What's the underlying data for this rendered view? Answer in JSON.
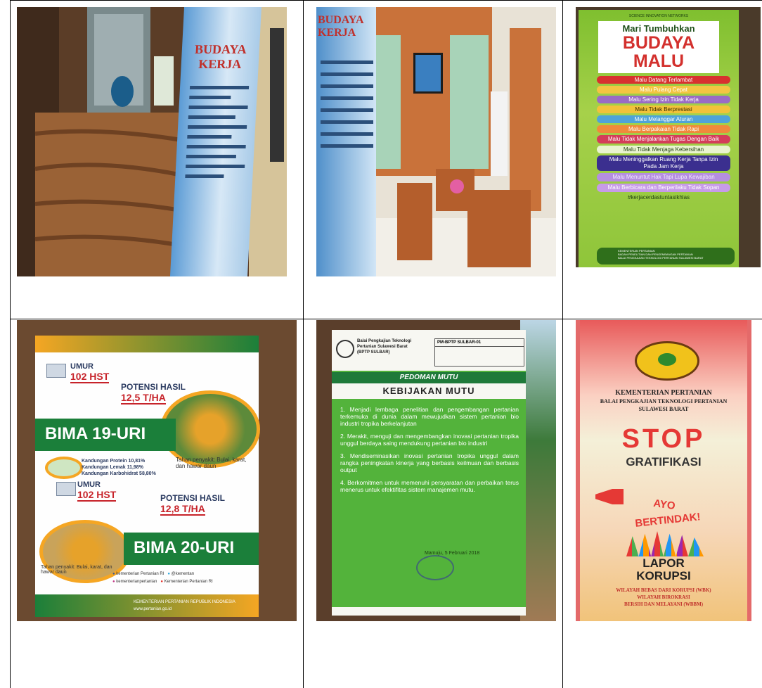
{
  "photo1": {
    "banner_title_1": "BUDAYA",
    "banner_title_2": "KERJA"
  },
  "photo2": {
    "banner_title_1": "BUDAYA",
    "banner_title_2": "KERJA"
  },
  "photo3": {
    "header_small": "SCIENCE INNOVATION NETWORKS",
    "intro": "Mari Tumbuhkan",
    "title_1": "BUDAYA",
    "title_2": "MALU",
    "items": [
      {
        "label": "Malu Datang Terlambat",
        "color": "#d8312f"
      },
      {
        "label": "Malu Pulang Cepat",
        "color": "#f4c542"
      },
      {
        "label": "Malu Sering Izin Tidak Kerja",
        "color": "#9a6bc5"
      },
      {
        "label": "Malu Tidak Berprestasi",
        "color": "#f2c23a"
      },
      {
        "label": "Malu Melanggar Aturan",
        "color": "#4fa3d9"
      },
      {
        "label": "Malu Berpakaian Tidak Rapi",
        "color": "#f08a3b"
      },
      {
        "label": "Malu Tidak Menjalankan Tugas Dengan Baik",
        "color": "#d43d5a"
      },
      {
        "label": "Malu Tidak Menjaga Kebersihan",
        "color": "#e9f4d0"
      },
      {
        "label": "Malu Meninggalkan Ruang Kerja Tanpa Izin Pada Jam Kerja",
        "color": "#3b2f8f"
      },
      {
        "label": "Malu Menuntut Hak Tapi Lupa Kewajiban",
        "color": "#b58ee0"
      },
      {
        "label": "Malu Berbicara dan Berperilaku Tidak Sopan",
        "color": "#c79be8"
      }
    ],
    "hashtag": "#kerjacerdastuntasikhlas",
    "footer_1": "KEMENTERIAN PERTANIAN",
    "footer_2": "BADAN PENELITIAN DAN PENGEMBANGAN PERTANIAN",
    "footer_3": "BALAI PENGKAJIAN TEKNOLOGI PERTANIAN SULAWESI BARAT"
  },
  "photo4": {
    "umur_label_1": "UMUR",
    "umur_value_1": "102 HST",
    "potensi_label_1": "POTENSI HASIL",
    "potensi_value_1": "12,5 T/HA",
    "variety_1": "BIMA 19-URI",
    "tahan_1": "Tahan penyakit: Bulai, karat, dan hawar daun",
    "kandungan": [
      "Kandungan Protein 10,81%",
      "Kandungan Lemak 11,98%",
      "Kandungan Karbohidrat 58,80%"
    ],
    "umur_label_2": "UMUR",
    "umur_value_2": "102 HST",
    "potensi_label_2": "POTENSI HASIL",
    "potensi_value_2": "12,8 T/HA",
    "variety_2": "BIMA 20-URI",
    "tahan_2": "Tahan penyakit: Bulai, karat, dan hawar daun",
    "social": [
      "kementerian Pertanian RI",
      "@kementan",
      "kementerianpertanian",
      "Kementerian Pertanian RI"
    ],
    "footer": "KEMENTERIAN PERTANIAN REPUBLIK INDONESIA",
    "website": "www.pertanian.go.id"
  },
  "photo5": {
    "org_1": "Balai Pengkajian Teknologi",
    "org_2": "Pertanian Sulawesi Barat",
    "org_3": "(BPTP SULBAR)",
    "doc_code": "PM-BPTP SULBAR-01",
    "header_band": "PEDOMAN MUTU",
    "title": "KEBIJAKAN MUTU",
    "points": [
      "1. Menjadi lembaga penelitian dan pengembangan pertanian terkemuka di dunia dalam mewujudkan sistem pertanian bio industri tropika berkelanjutan",
      "2. Merakit, menguji dan mengembangkan inovasi pertanian tropika unggul berdaya saing mendukung pertanian bio industri",
      "3. Mendiseminasikan inovasi pertanian tropika unggul dalam rangka peningkatan kinerja yang berbasis keilmuan dan berbasis output",
      "4. Berkomitmen untuk memenuhi persyaratan dan perbaikan terus menerus untuk efektifitas sistem manajemen mutu."
    ],
    "sign_date": "Mamuju, 5 Februari 2018"
  },
  "photo6": {
    "org_1": "KEMENTERIAN PERTANIAN",
    "org_2": "BALAI PENGKAJIAN TEKNOLOGI PERTANIAN",
    "org_3": "SULAWESI BARAT",
    "stop": "STOP",
    "gratifikasi": "GRATIFIKASI",
    "ayo": "AYO",
    "bertindak": "BERTINDAK!",
    "lapor": "LAPOR",
    "korupsi": "KORUPSI",
    "wbk_1": "WILAYAH BEBAS DARI KORUPSI (WBK)",
    "wbk_2": "WILAYAH BIROKRASI",
    "wbk_3": "BERSIH DAN MELAYANI (WBBM)"
  }
}
